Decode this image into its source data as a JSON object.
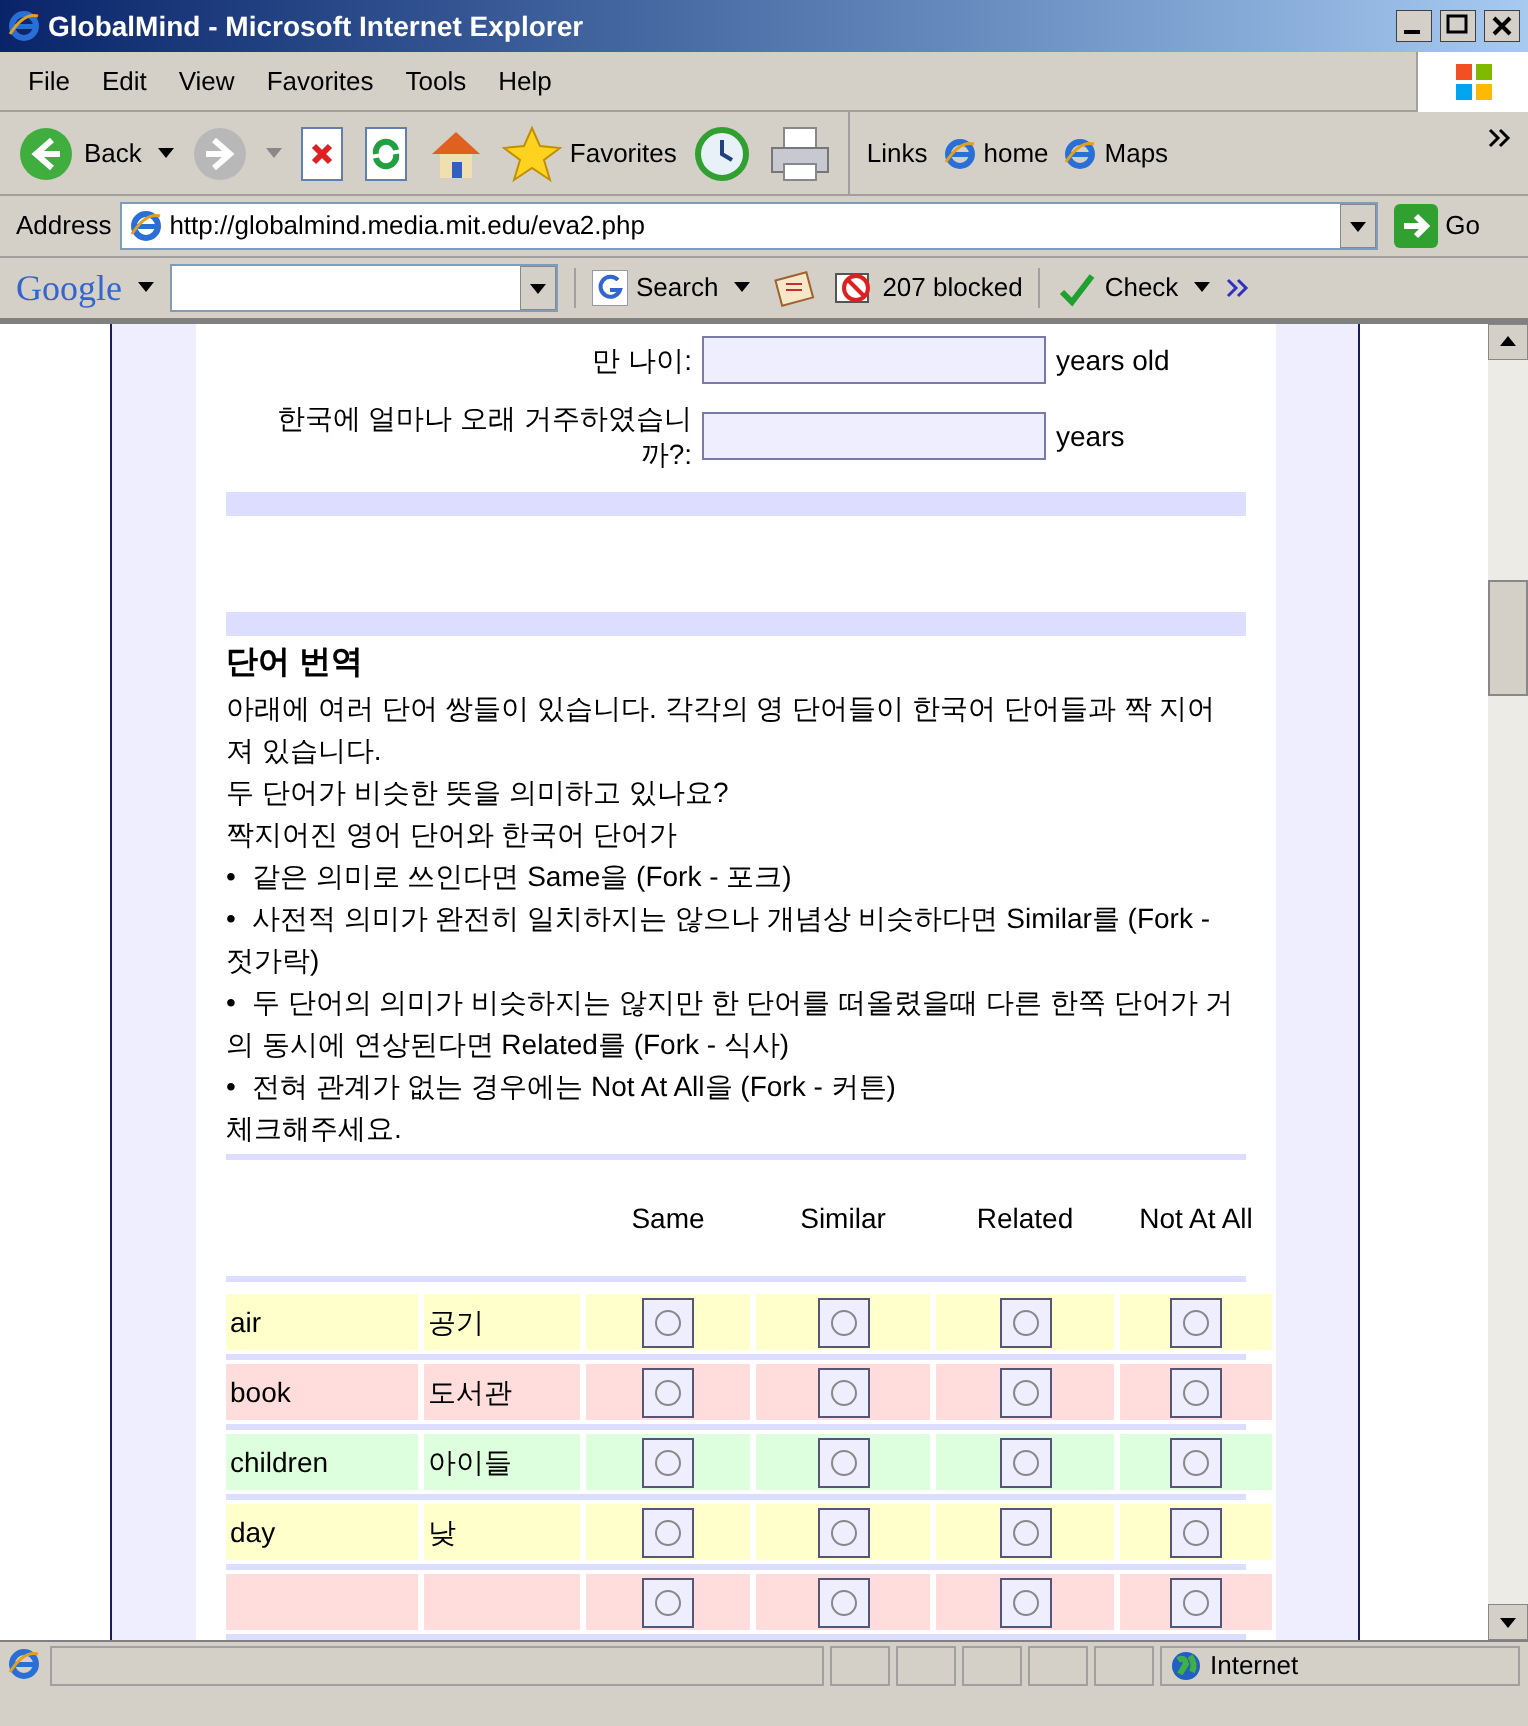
{
  "window": {
    "title": "GlobalMind - Microsoft Internet Explorer"
  },
  "menu": [
    "File",
    "Edit",
    "View",
    "Favorites",
    "Tools",
    "Help"
  ],
  "toolbar": {
    "back": "Back",
    "favorites": "Favorites",
    "links_label": "Links",
    "links": [
      "home",
      "Maps"
    ]
  },
  "address_bar": {
    "label": "Address",
    "url": "http://globalmind.media.mit.edu/eva2.php",
    "go": "Go"
  },
  "google_bar": {
    "logo": "Google",
    "search": "Search",
    "blocked": "207 blocked",
    "check": "Check"
  },
  "form": {
    "fields": [
      {
        "label": "만 나이:",
        "unit": "years old"
      },
      {
        "label": "한국에 얼마나 오래 거주하였습니까?:",
        "unit": "years"
      }
    ]
  },
  "section": {
    "title": "단어 번역",
    "lines": [
      "아래에 여러 단어 쌍들이 있습니다. 각각의 영 단어들이 한국어 단어들과 짝 지어져 있습니다.",
      "두 단어가 비슷한 뜻을 의미하고 있나요?",
      "짝지어진 영어 단어와 한국어 단어가"
    ],
    "bullets": [
      "•",
      "•",
      "•",
      "•"
    ],
    "bullet_texts": [
      "같은 의미로 쓰인다면 Same을 (Fork - 포크)",
      "사전적 의미가 완전히 일치하지는 않으나 개념상 비슷하다면 Similar를 (Fork - 젓가락)",
      "두 단어의 의미가 비슷하지는 않지만 한 단어를 떠올렸을때 다른 한쪽 단어가 거의 동시에 연상된다면 Related를 (Fork - 식사)",
      "전혀 관계가 없는 경우에는 Not At All을 (Fork - 커튼)"
    ],
    "closing": "체크해주세요."
  },
  "table": {
    "columns": [
      "Same",
      "Similar",
      "Related",
      "Not At All"
    ],
    "rows": [
      {
        "english": "air",
        "korean": "공기",
        "color": "#ffffcc",
        "options": [
          {
            "selected": false
          },
          {
            "selected": false
          },
          {
            "selected": false
          },
          {
            "selected": false
          }
        ]
      },
      {
        "english": "book",
        "korean": "도서관",
        "color": "#ffdddd",
        "options": [
          {
            "selected": false
          },
          {
            "selected": false
          },
          {
            "selected": false
          },
          {
            "selected": false
          }
        ]
      },
      {
        "english": "children",
        "korean": "아이들",
        "color": "#ddffdd",
        "options": [
          {
            "selected": false
          },
          {
            "selected": false
          },
          {
            "selected": false
          },
          {
            "selected": false
          }
        ]
      },
      {
        "english": "day",
        "korean": "낮",
        "color": "#ffffcc",
        "options": [
          {
            "selected": false
          },
          {
            "selected": false
          },
          {
            "selected": false
          },
          {
            "selected": false
          }
        ]
      },
      {
        "color": "#ffdddd",
        "options": [
          {
            "selected": false
          },
          {
            "selected": false
          },
          {
            "selected": false
          },
          {
            "selected": false
          }
        ]
      }
    ]
  },
  "status_bar": {
    "zone": "Internet"
  }
}
